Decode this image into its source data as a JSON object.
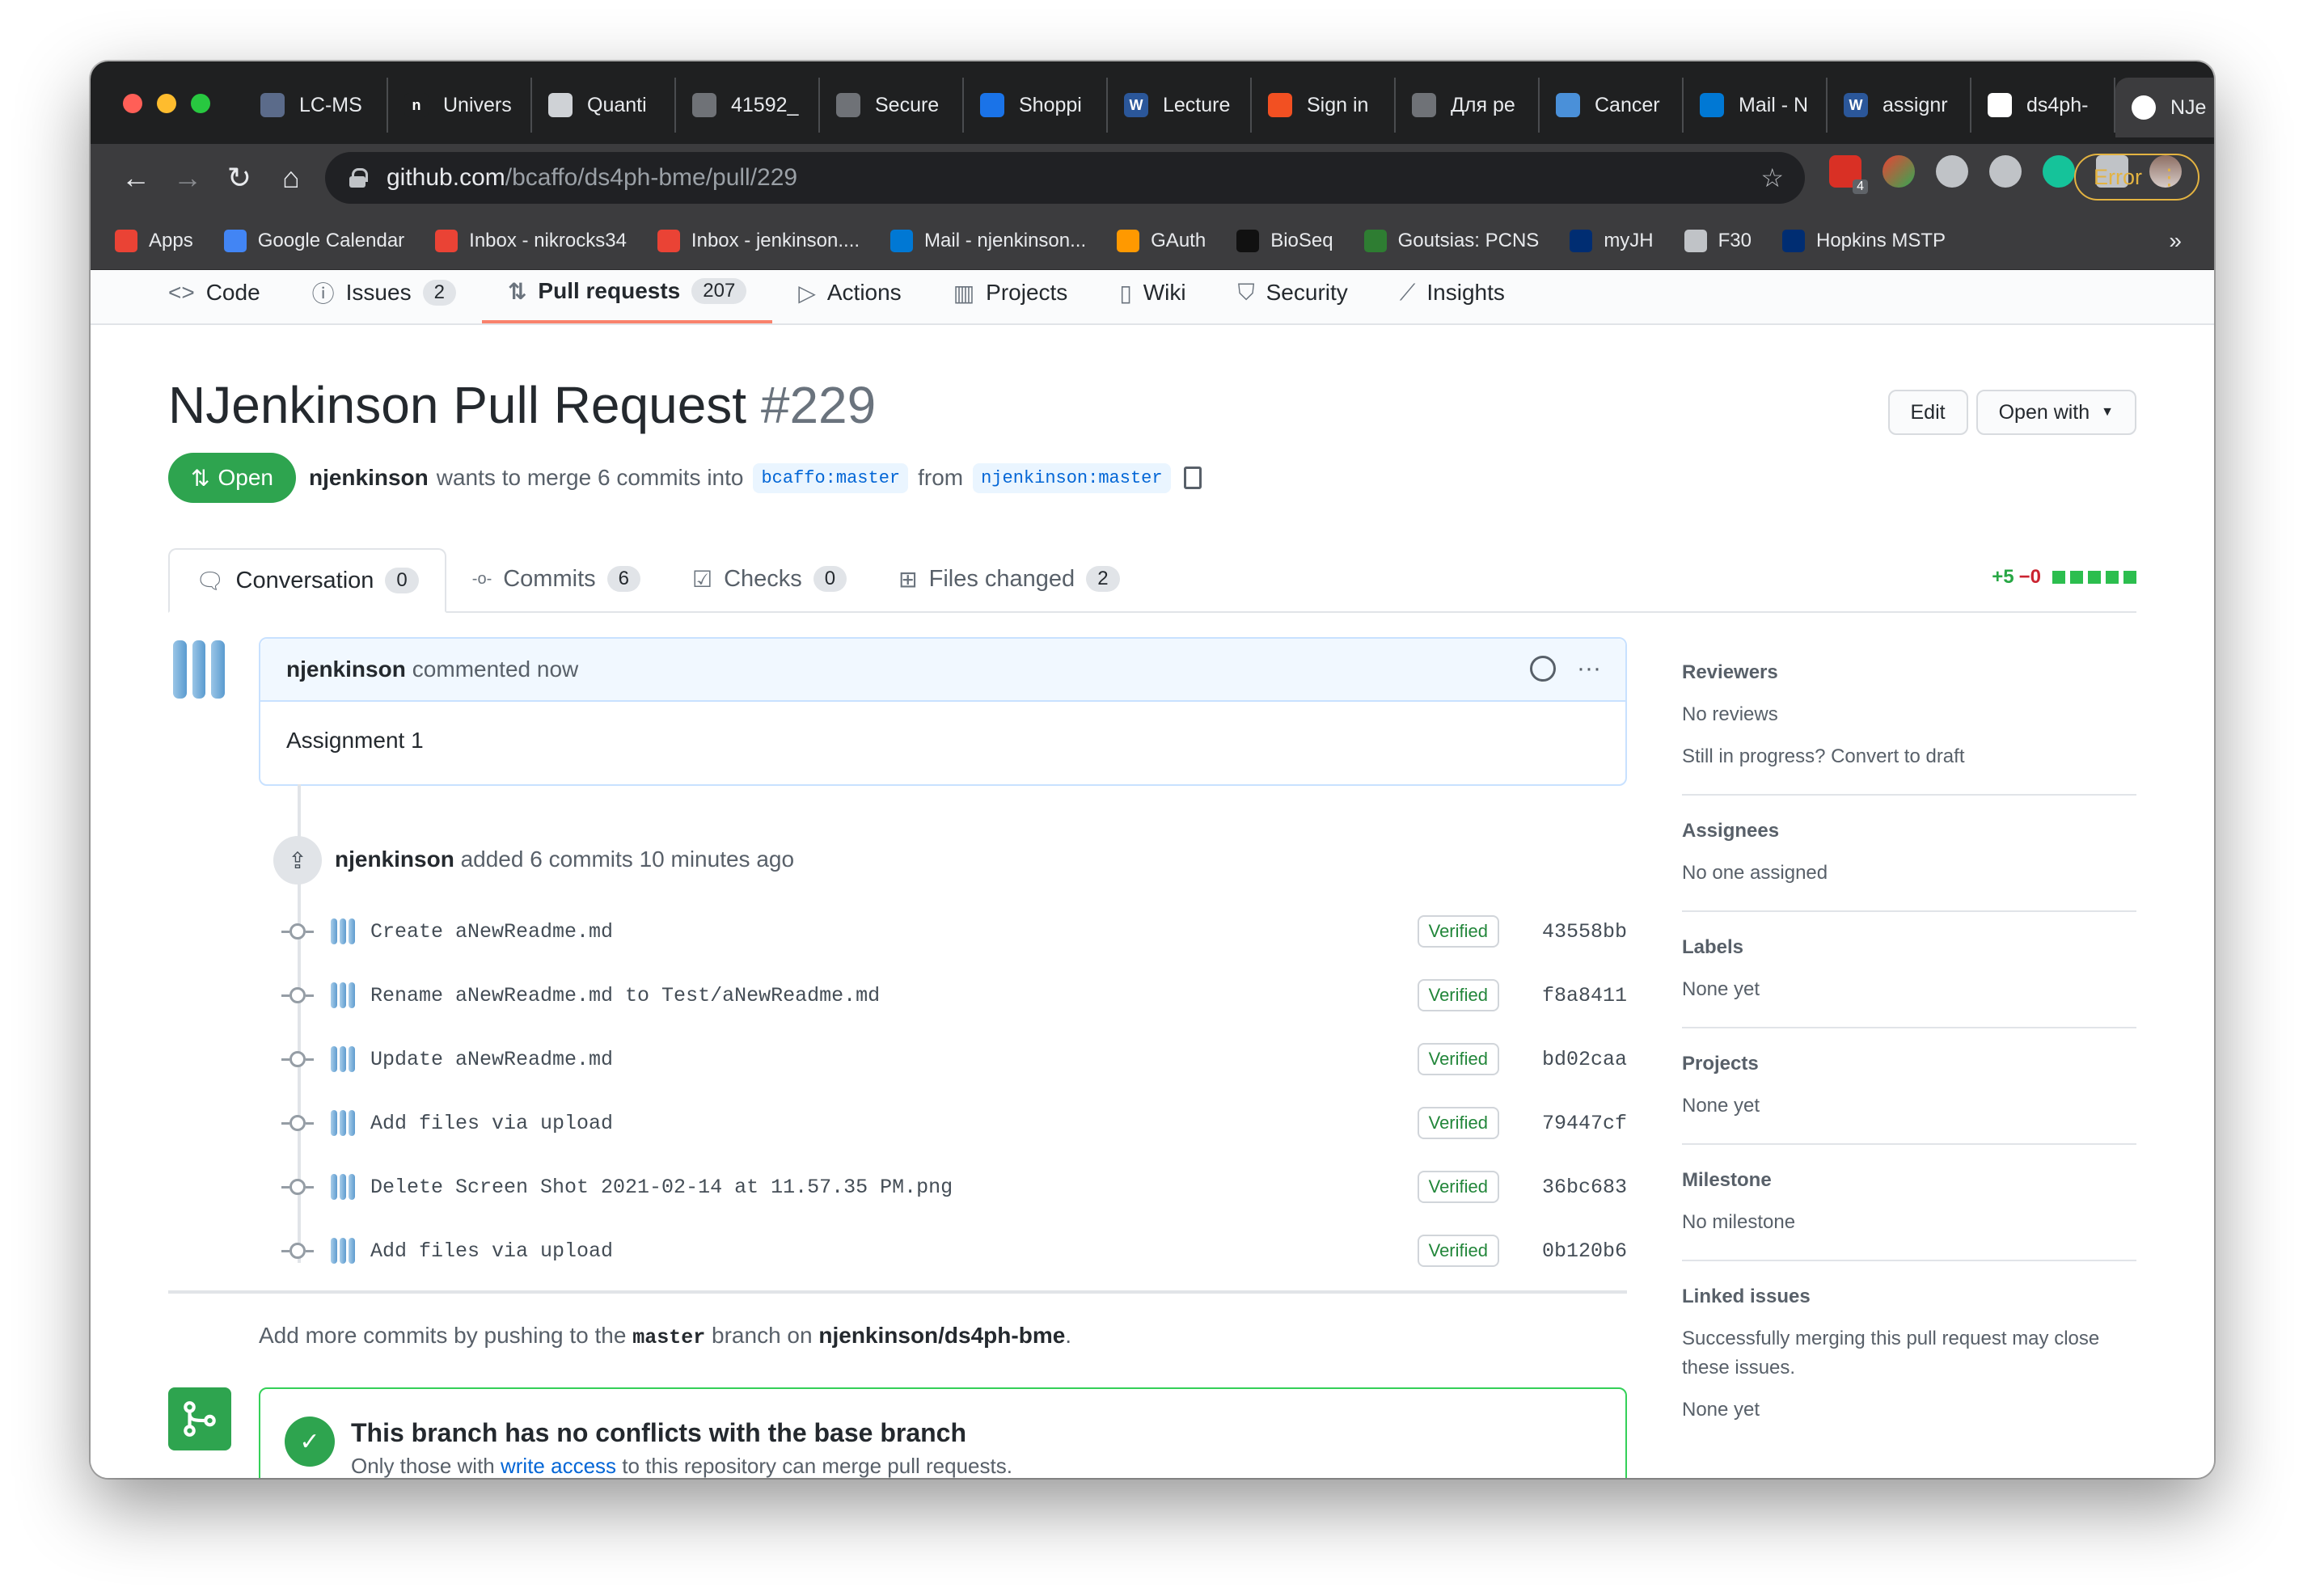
{
  "browser": {
    "tabs": [
      {
        "label": "LC-MS",
        "color": "#5b6b8a"
      },
      {
        "label": "Univers",
        "color": "#1f2021",
        "glyph": "n"
      },
      {
        "label": "Quanti",
        "color": "#cfd2d6"
      },
      {
        "label": "41592_",
        "color": "#6f7277"
      },
      {
        "label": "Secure",
        "color": "#6f7277"
      },
      {
        "label": "Shoppi",
        "color": "#1a73e8"
      },
      {
        "label": "Lecture",
        "color": "#2b579a",
        "glyph": "W"
      },
      {
        "label": "Sign in",
        "color": "#f25022"
      },
      {
        "label": "Для ре",
        "color": "#6f7277"
      },
      {
        "label": "Cancer",
        "color": "#4a90d9"
      },
      {
        "label": "Mail - N",
        "color": "#0078d4"
      },
      {
        "label": "assignr",
        "color": "#2b579a",
        "glyph": "W"
      },
      {
        "label": "ds4ph-",
        "color": "#ffffff"
      }
    ],
    "active_tab": {
      "label": "NJe",
      "close": "✕"
    },
    "new_tab": "+",
    "url_host": "github.com",
    "url_path": "/bcaffo/ds4ph-bme/pull/229",
    "error_button": "Error",
    "extension_badge": "4",
    "bookmarks": [
      {
        "label": "Apps",
        "color": "#ea4335"
      },
      {
        "label": "Google Calendar",
        "color": "#4285f4"
      },
      {
        "label": "Inbox - nikrocks34",
        "color": "#ea4335"
      },
      {
        "label": "Inbox - jenkinson....",
        "color": "#ea4335"
      },
      {
        "label": "Mail - njenkinson...",
        "color": "#0078d4"
      },
      {
        "label": "GAuth",
        "color": "#ff9900"
      },
      {
        "label": "BioSeq",
        "color": "#111111"
      },
      {
        "label": "Goutsias: PCNS",
        "color": "#2e7d32"
      },
      {
        "label": "myJH",
        "color": "#002d72"
      },
      {
        "label": "F30",
        "color": "#c0c3c7"
      },
      {
        "label": "Hopkins MSTP",
        "color": "#002d72"
      }
    ],
    "bookmarks_more": "»"
  },
  "repo_nav": [
    {
      "label": "Code",
      "icon": "code-icon",
      "glyph": "<>"
    },
    {
      "label": "Issues",
      "icon": "issue-icon",
      "glyph": "ⓘ",
      "count": "2"
    },
    {
      "label": "Pull requests",
      "icon": "pull-request-icon",
      "glyph": "⇅",
      "count": "207",
      "selected": true
    },
    {
      "label": "Actions",
      "icon": "play-icon",
      "glyph": "▷"
    },
    {
      "label": "Projects",
      "icon": "project-icon",
      "glyph": "▥"
    },
    {
      "label": "Wiki",
      "icon": "book-icon",
      "glyph": "▯"
    },
    {
      "label": "Security",
      "icon": "shield-icon",
      "glyph": "⛉"
    },
    {
      "label": "Insights",
      "icon": "graph-icon",
      "glyph": "⟋"
    }
  ],
  "pr": {
    "title": "NJenkinson Pull Request",
    "number": "#229",
    "state": "Open",
    "author": "njenkinson",
    "merge_text": "wants to merge 6 commits into",
    "base_branch": "bcaffo:master",
    "from_text": "from",
    "head_branch": "njenkinson:master",
    "edit_button": "Edit",
    "open_with_button": "Open with"
  },
  "pr_tabs": [
    {
      "label": "Conversation",
      "count": "0",
      "icon": "comment-icon",
      "selected": true
    },
    {
      "label": "Commits",
      "count": "6",
      "icon": "commit-icon"
    },
    {
      "label": "Checks",
      "count": "0",
      "icon": "checklist-icon"
    },
    {
      "label": "Files changed",
      "count": "2",
      "icon": "file-diff-icon"
    }
  ],
  "diffstat": {
    "additions": "+5",
    "deletions": "−0",
    "color": "#2cbe4e"
  },
  "comment": {
    "author": "njenkinson",
    "action": "commented now",
    "body": "Assignment 1",
    "more": "···"
  },
  "push_event": {
    "author": "njenkinson",
    "text": "added 6 commits",
    "time": "10 minutes ago"
  },
  "commits": [
    {
      "message": "Create aNewReadme.md",
      "verified": "Verified",
      "sha": "43558bb"
    },
    {
      "message": "Rename aNewReadme.md to Test/aNewReadme.md",
      "verified": "Verified",
      "sha": "f8a8411"
    },
    {
      "message": "Update aNewReadme.md",
      "verified": "Verified",
      "sha": "bd02caa"
    },
    {
      "message": "Add files via upload",
      "verified": "Verified",
      "sha": "79447cf"
    },
    {
      "message": "Delete Screen Shot 2021-02-14 at 11.57.35 PM.png",
      "verified": "Verified",
      "sha": "36bc683"
    },
    {
      "message": "Add files via upload",
      "verified": "Verified",
      "sha": "0b120b6"
    }
  ],
  "add_more": {
    "prefix": "Add more commits by pushing to the",
    "branch": "master",
    "middle": "branch on",
    "repo": "njenkinson/ds4ph-bme",
    "suffix": "."
  },
  "merge": {
    "heading": "This branch has no conflicts with the base branch",
    "sub_prefix": "Only those with",
    "sub_link": "write access",
    "sub_suffix": "to this repository can merge pull requests.",
    "color": "#2ea44f"
  },
  "sidebar": {
    "reviewers": {
      "heading": "Reviewers",
      "value": "No reviews",
      "extra": "Still in progress? Convert to draft"
    },
    "assignees": {
      "heading": "Assignees",
      "value": "No one assigned"
    },
    "labels": {
      "heading": "Labels",
      "value": "None yet"
    },
    "projects": {
      "heading": "Projects",
      "value": "None yet"
    },
    "milestone": {
      "heading": "Milestone",
      "value": "No milestone"
    },
    "linked_issues": {
      "heading": "Linked issues",
      "value": "Successfully merging this pull request may close these issues.",
      "extra": "None yet"
    }
  }
}
